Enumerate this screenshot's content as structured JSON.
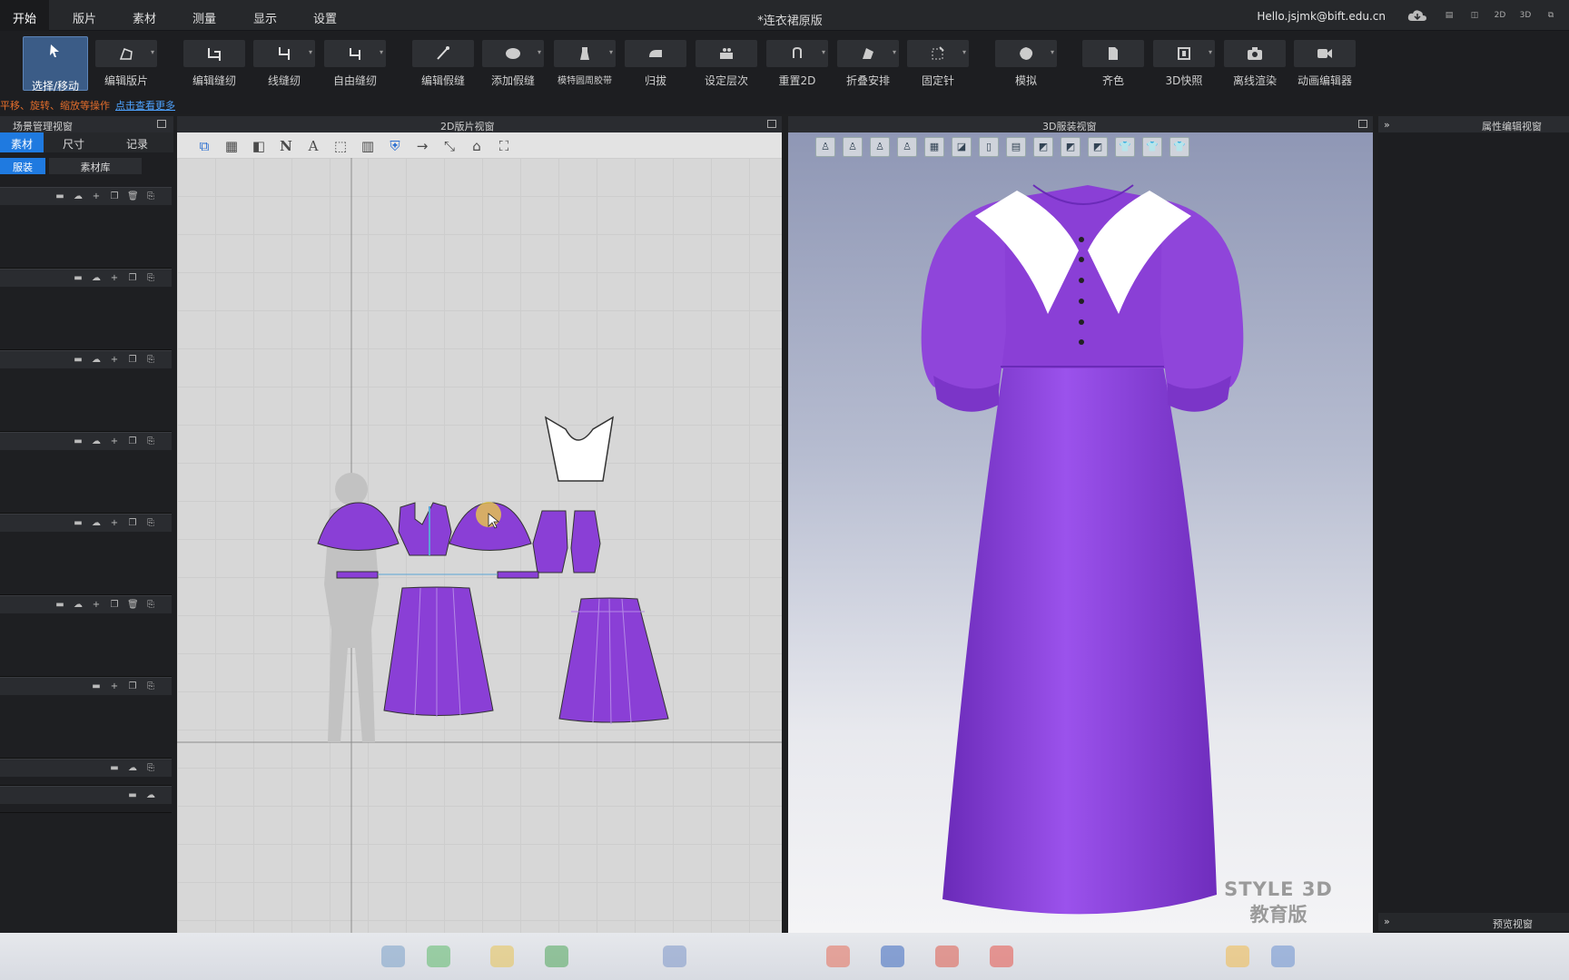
{
  "menubar": {
    "items": [
      "开始",
      "版片",
      "素材",
      "测量",
      "显示",
      "设置"
    ],
    "doc_title": "*连衣裙原版",
    "user": "Hello.jsjmk@bift.edu.cn",
    "view_modes": [
      "▤",
      "◫",
      "2D",
      "3D",
      "⧉"
    ]
  },
  "toolbar": {
    "tools": [
      {
        "label": "选择/移动",
        "icon": "select-arrow-icon"
      },
      {
        "label": "编辑版片",
        "icon": "edit-pattern-icon"
      },
      {
        "label": "编辑缝纫",
        "icon": "edit-sewing-icon"
      },
      {
        "label": "线缝纫",
        "icon": "segment-sewing-icon"
      },
      {
        "label": "自由缝纫",
        "icon": "free-sewing-icon"
      },
      {
        "label": "编辑假缝",
        "icon": "edit-tack-icon"
      },
      {
        "label": "添加假缝",
        "icon": "add-tack-icon"
      },
      {
        "label": "模特圆周胶带",
        "icon": "avatar-tape-icon"
      },
      {
        "label": "归拔",
        "icon": "iron-icon"
      },
      {
        "label": "设定层次",
        "icon": "layer-icon"
      },
      {
        "label": "重置2D",
        "icon": "reset-2d-icon"
      },
      {
        "label": "折叠安排",
        "icon": "fold-arrange-icon"
      },
      {
        "label": "固定针",
        "icon": "pin-icon"
      },
      {
        "label": "模拟",
        "icon": "simulate-icon"
      },
      {
        "label": "齐色",
        "icon": "colorway-icon"
      },
      {
        "label": "3D快照",
        "icon": "snapshot-3d-icon"
      },
      {
        "label": "离线渲染",
        "icon": "camera-icon"
      },
      {
        "label": "动画编辑器",
        "icon": "video-camera-icon"
      }
    ]
  },
  "hint": {
    "text": "平移、旋转、缩放等操作",
    "link": "点击查看更多"
  },
  "scene_panel": {
    "title": "场景管理视窗",
    "tabs": [
      "素材",
      "尺寸",
      "记录"
    ],
    "subtabs": [
      "服装",
      "素材库"
    ]
  },
  "view2d": {
    "title": "2D版片视窗",
    "tools": [
      "⧉",
      "▦",
      "◧",
      "N",
      "A",
      "⬚",
      "▥",
      "⛨",
      "→",
      "⤡",
      "⌂",
      "⛶"
    ]
  },
  "view3d": {
    "title": "3D服装视窗",
    "watermark_line1": "STYLE 3D",
    "watermark_line2": "教育版"
  },
  "property_panel": {
    "title": "属性编辑视窗",
    "preview_title": "预览视窗"
  },
  "colors": {
    "accent": "#3b5c87",
    "fabric": "#8a3fd6",
    "collar": "#ffffff",
    "hint_orange": "#e36d2b",
    "link_blue": "#4ea3ff"
  }
}
